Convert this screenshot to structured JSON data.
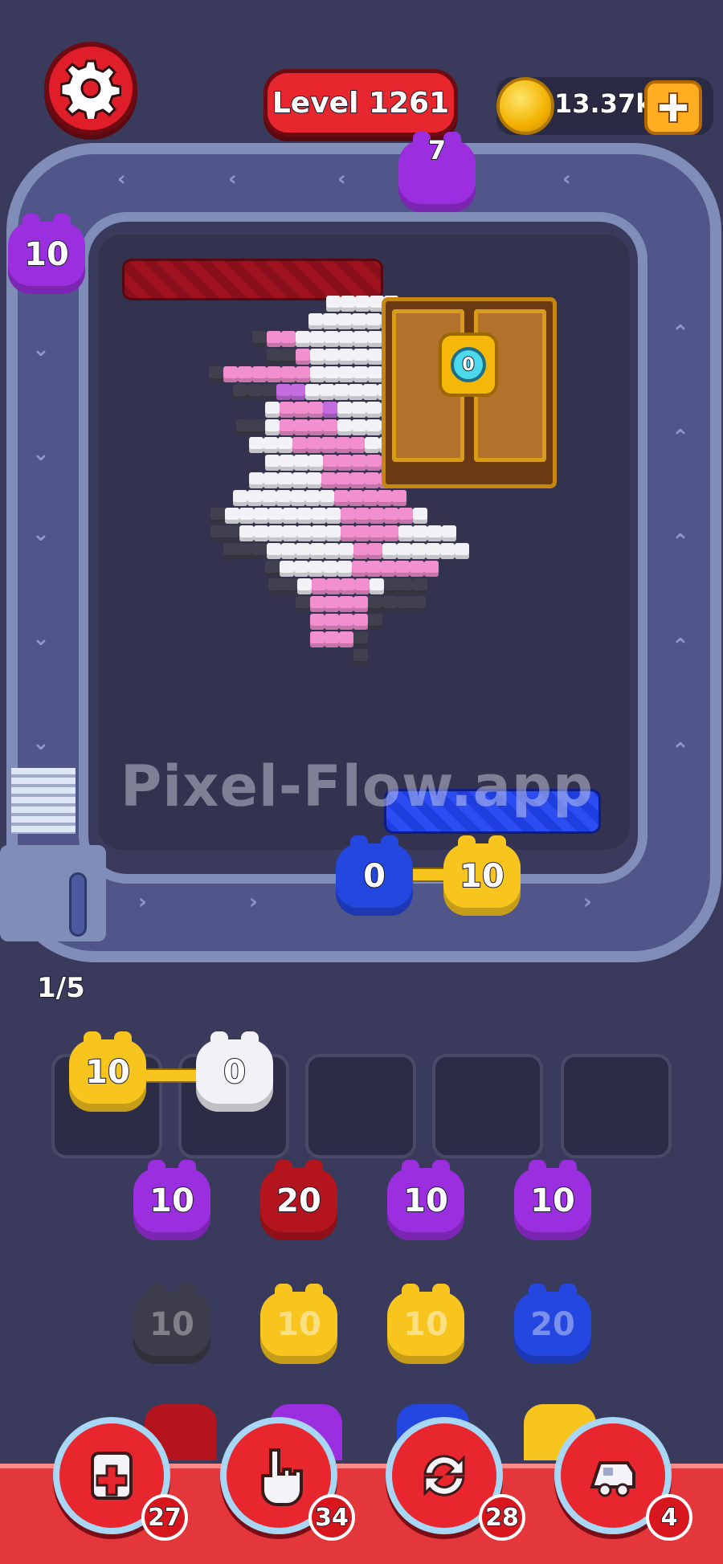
{
  "header": {
    "level_label": "Level 1261",
    "coins": "13.37k"
  },
  "conveyor": {
    "progress": "1/5",
    "units": [
      {
        "color": "#9b2fe0",
        "count": "7"
      },
      {
        "color": "#9b2fe0",
        "count": "10"
      },
      {
        "color": "#2447e0",
        "count": "0"
      },
      {
        "color": "#f7c51e",
        "count": "10"
      }
    ]
  },
  "board": {
    "chest_lock_count": "0",
    "watermark": "Pixel-Flow.app",
    "art_colors": {
      "white": "#f2f2f6",
      "pink": "#f28fce",
      "gray": "#40404e",
      "magenta": "#c46be0"
    }
  },
  "queue": [
    {
      "color": "#f7c51e",
      "count": "10"
    },
    {
      "color": "#f2f2f6",
      "count": "0"
    }
  ],
  "grid": {
    "row1": [
      {
        "color": "#9b2fe0",
        "count": "10"
      },
      {
        "color": "#b3141e",
        "count": "20"
      },
      {
        "color": "#9b2fe0",
        "count": "10"
      },
      {
        "color": "#9b2fe0",
        "count": "10"
      }
    ],
    "row2": [
      {
        "color": "#3c3c4a",
        "count": "10"
      },
      {
        "color": "#f7c51e",
        "count": "10"
      },
      {
        "color": "#f7c51e",
        "count": "10"
      },
      {
        "color": "#2447e0",
        "count": "20"
      }
    ]
  },
  "toolbar": {
    "add_slot_count": "27",
    "hand_count": "34",
    "shuffle_count": "28",
    "train_count": "4"
  },
  "colors": {
    "red": "#e8262e",
    "gold": "#f2b100",
    "conveyor": "#7f8db8"
  }
}
